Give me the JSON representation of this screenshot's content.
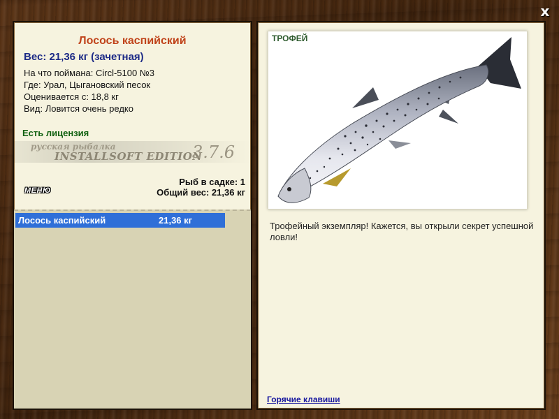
{
  "window": {
    "close_label": "x"
  },
  "catch": {
    "title": "Лосось каспийский",
    "weight_line": "Вес: 21,36 кг (зачетная)",
    "details": [
      "На что поймана: Circl-5100 №3",
      "Где: Урал, Цыгановский песок",
      "Оценивается с: 18,8 кг",
      "Вид: Ловится очень редко"
    ],
    "license": "Есть лицензия"
  },
  "branding": {
    "small": "русская рыбалка",
    "big": "Installsoft Edition",
    "version": "3.7.6"
  },
  "menu_label": "МЕНЮ",
  "keepnet": {
    "count_line": "Рыб в садке: 1",
    "total_line": "Общий вес: 21,36 кг",
    "items": [
      {
        "name": "Лосось каспийский",
        "weight": "21,36 кг"
      }
    ]
  },
  "trophy": {
    "label": "ТРОФЕЙ",
    "description": "Трофейный экземпляр! Кажется, вы открыли секрет успешной ловли!",
    "hotkeys_link": "Горячие клавиши"
  },
  "icons": {
    "close": "close-icon",
    "fish": "salmon-image"
  }
}
